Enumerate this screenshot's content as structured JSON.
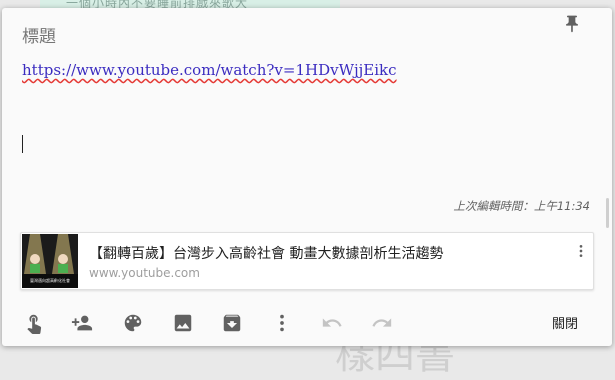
{
  "background": {
    "top_text": "一個小時內不要睡前排戲來歌大",
    "bottom_text": "樣四書"
  },
  "note": {
    "title": "標題",
    "body_link": "https://www.youtube.com/watch?v=1HDvWjjEikc",
    "edited_label": "上次編輯時間：上午11:34"
  },
  "link_preview": {
    "title": "【翻轉百歲】台灣步入高齡社會 動畫大數據剖析生活趨勢",
    "domain": "www.youtube.com",
    "thumbnail_caption": "臺灣邁向超高齡化社會"
  },
  "toolbar": {
    "icons": [
      "touch-icon",
      "add-person-icon",
      "palette-icon",
      "image-icon",
      "archive-icon",
      "more-vert-icon",
      "undo-icon",
      "redo-icon"
    ],
    "close_label": "關閉"
  },
  "colors": {
    "link": "#3b2cc0",
    "spell_underline": "#e53935",
    "icon": "#616161",
    "disabled_icon": "#c4c4c4"
  }
}
